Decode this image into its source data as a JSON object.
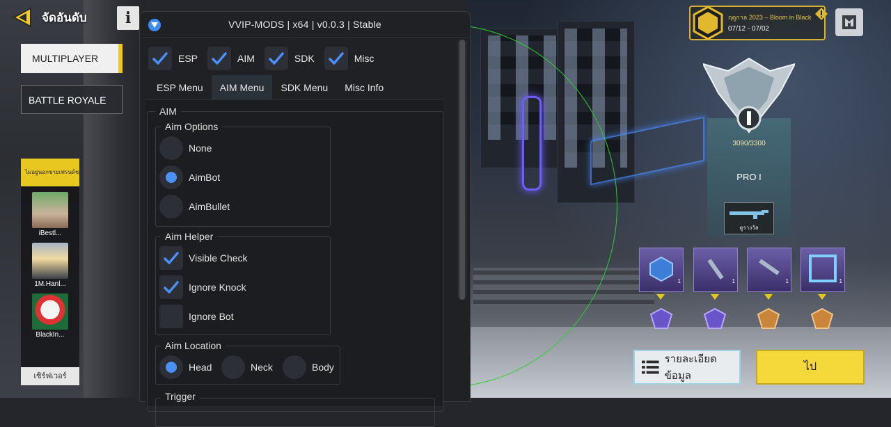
{
  "game": {
    "rank_title": "จัดอันดับ",
    "info_label": "i",
    "modes": [
      "MULTIPLAYER",
      "BATTLE ROYALE"
    ],
    "friends_header": "ไม่อยู่นอกชายเฟรนด์ช",
    "friends": [
      {
        "name": "iBestl..."
      },
      {
        "name": "1M.Hanl..."
      },
      {
        "name": "BlackIn..."
      }
    ],
    "server_label": "เซิร์ฟเวอร์",
    "season_name": "ฤดูกาล 2023 – Bloom in Black",
    "season_dates": "07/12 - 07/02",
    "rank_points": "3090/3300",
    "rank_name": "PRO I",
    "reward_weapon_label": "ดูรางวัล",
    "reward_qty": [
      "1",
      "1",
      "1",
      "1"
    ],
    "details_button": "รายละเอียดข้อมูล",
    "go_button": "ไป"
  },
  "menu": {
    "title": "VVIP-MODS | x64 | v0.0.3 | Stable",
    "checks": [
      {
        "label": "ESP",
        "checked": true
      },
      {
        "label": "AIM",
        "checked": true
      },
      {
        "label": "SDK",
        "checked": true
      },
      {
        "label": "Misc",
        "checked": true
      }
    ],
    "tabs": [
      "ESP Menu",
      "AIM Menu",
      "SDK Menu",
      "Misc Info"
    ],
    "active_tab": "AIM Menu",
    "group_label": "AIM",
    "aim_options": {
      "label": "Aim Options",
      "items": [
        "None",
        "AimBot",
        "AimBullet"
      ],
      "selected": "AimBot"
    },
    "aim_helper": {
      "label": "Aim Helper",
      "items": [
        {
          "label": "Visible Check",
          "checked": true
        },
        {
          "label": "Ignore Knock",
          "checked": true
        },
        {
          "label": "Ignore Bot",
          "checked": false
        }
      ]
    },
    "aim_location": {
      "label": "Aim Location",
      "items": [
        "Head",
        "Neck",
        "Body"
      ],
      "selected": "Head"
    },
    "trigger_label": "Trigger"
  },
  "colors": {
    "accent_blue": "#4b8ff8",
    "fov_green": "#2ed12e",
    "gold": "#f5d93a"
  }
}
